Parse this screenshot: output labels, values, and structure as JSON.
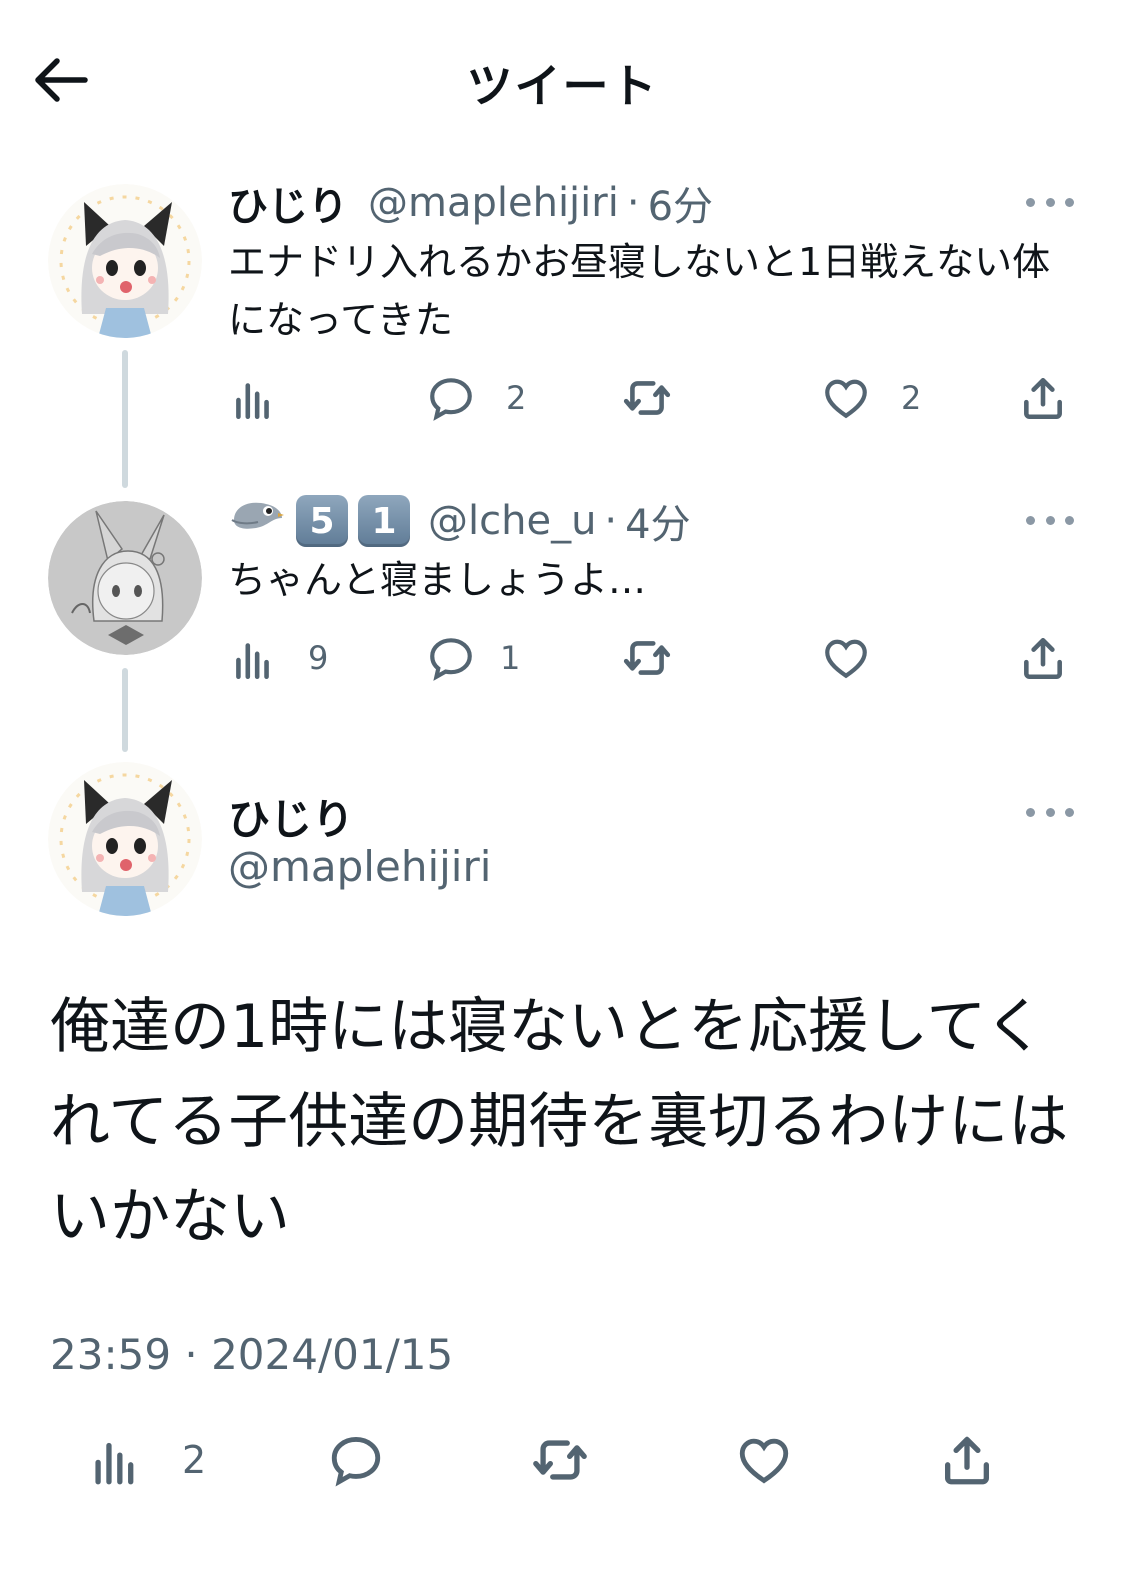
{
  "header": {
    "title": "ツイート",
    "back_icon": "arrow-left-icon"
  },
  "colors": {
    "text": "#0f1419",
    "secondary": "#536471",
    "thread_line": "#cfd9de",
    "icon": "#536471"
  },
  "tweets": [
    {
      "display_name": "ひじり",
      "handle": "@maplehijiri",
      "separator": "·",
      "time_ago": "6分",
      "text": "エナドリ入れるかお昼寝しないと1日戦えない体になってきた",
      "views": "",
      "replies": "2",
      "retweets": "",
      "likes": "2"
    },
    {
      "display_name_badges": [
        "5",
        "1"
      ],
      "handle": "@lche_u",
      "separator": "·",
      "time_ago": "4分",
      "text": "ちゃんと寝ましょうよ…",
      "views": "9",
      "replies": "1",
      "retweets": "",
      "likes": ""
    }
  ],
  "main_tweet": {
    "display_name": "ひじり",
    "handle": "@maplehijiri",
    "text": "俺達の1時には寝ないとを応援してくれてる子供達の期待を裏切るわけにはいかない",
    "timestamp": "23:59 · 2024/01/15",
    "views": "2"
  }
}
